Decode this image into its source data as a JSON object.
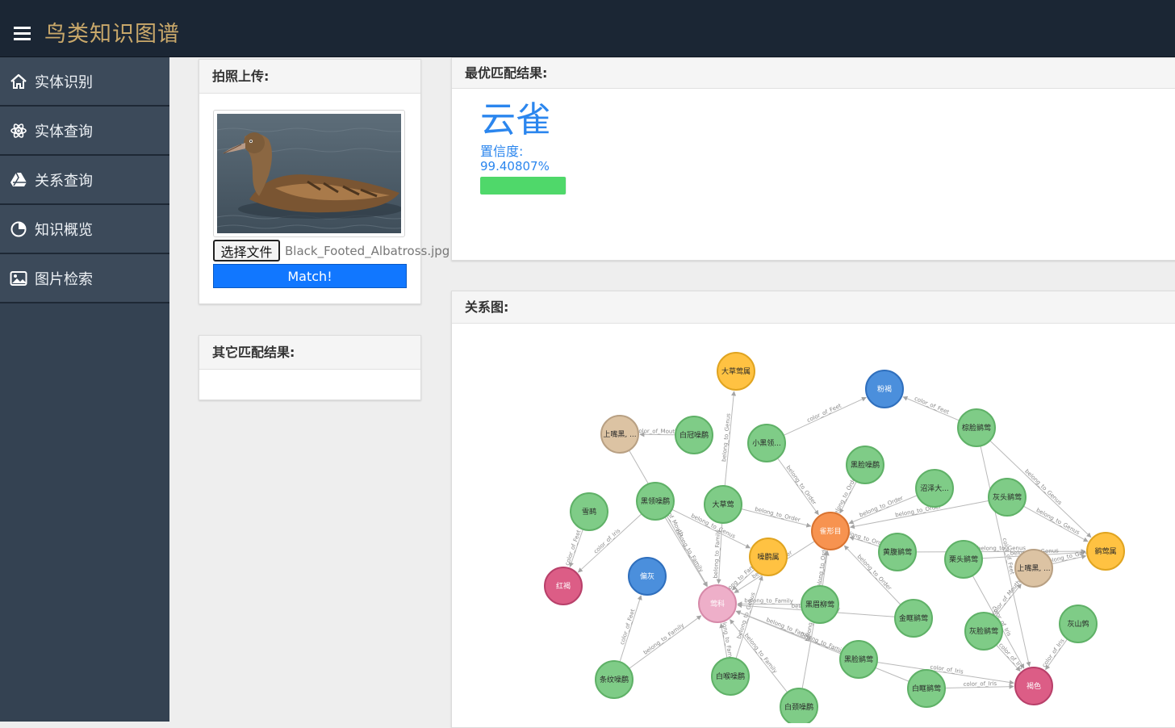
{
  "app": {
    "title": "鸟类知识图谱"
  },
  "sidebar": {
    "items": [
      {
        "label": "实体识别",
        "icon": "home-icon"
      },
      {
        "label": "实体查询",
        "icon": "atom-icon"
      },
      {
        "label": "关系查询",
        "icon": "drive-icon"
      },
      {
        "label": "知识概览",
        "icon": "pie-chart-icon"
      },
      {
        "label": "图片检索",
        "icon": "image-icon"
      }
    ]
  },
  "upload": {
    "title": "拍照上传:",
    "file_button": "选择文件",
    "file_name": "Black_Footed_Albatross.jpg",
    "match_button": "Match!"
  },
  "other_results": {
    "title": "其它匹配结果:"
  },
  "best": {
    "title": "最优匹配结果:",
    "name": "云雀",
    "confidence_label": "置信度:",
    "confidence_value": "99.40807%",
    "confidence_fraction": 0.994
  },
  "graph": {
    "title": "关系图:",
    "colors": {
      "green": "#7fcc87",
      "yellow": "#ffc242",
      "blue": "#4b8fdc",
      "tan": "#dcc3a3",
      "orange": "#f79350",
      "pink": "#eeafc9",
      "red": "#dc5d86"
    },
    "nodes": [
      {
        "id": "n1",
        "label": "大草莺属",
        "color": "yellow"
      },
      {
        "id": "n2",
        "label": "粉褐",
        "color": "blue"
      },
      {
        "id": "n3",
        "label": "上嘴黑, ...",
        "color": "tan"
      },
      {
        "id": "n4",
        "label": "白冠噪鹛",
        "color": "green"
      },
      {
        "id": "n5",
        "label": "小黑领...",
        "color": "green"
      },
      {
        "id": "n6",
        "label": "棕脸鹟莺",
        "color": "green"
      },
      {
        "id": "n7",
        "label": "黑脸噪鹛",
        "color": "green"
      },
      {
        "id": "n8",
        "label": "雪鹀",
        "color": "green"
      },
      {
        "id": "n9",
        "label": "黑领噪鹛",
        "color": "green"
      },
      {
        "id": "n10",
        "label": "大草莺",
        "color": "green"
      },
      {
        "id": "n11",
        "label": "沼泽大...",
        "color": "green"
      },
      {
        "id": "n12",
        "label": "灰头鹟莺",
        "color": "green"
      },
      {
        "id": "n13",
        "label": "雀形目",
        "color": "orange"
      },
      {
        "id": "n14",
        "label": "鹟莺属",
        "color": "yellow"
      },
      {
        "id": "n15",
        "label": "噪鹛属",
        "color": "yellow"
      },
      {
        "id": "n16",
        "label": "黄腹鹟莺",
        "color": "green"
      },
      {
        "id": "n17",
        "label": "栗头鹟莺",
        "color": "green"
      },
      {
        "id": "n18",
        "label": "上嘴黑, ...",
        "color": "tan"
      },
      {
        "id": "n19",
        "label": "红褐",
        "color": "red"
      },
      {
        "id": "n20",
        "label": "偏灰",
        "color": "blue"
      },
      {
        "id": "n21",
        "label": "莺科",
        "color": "pink"
      },
      {
        "id": "n22",
        "label": "黑眉柳莺",
        "color": "green"
      },
      {
        "id": "n23",
        "label": "金眶鹟莺",
        "color": "green"
      },
      {
        "id": "n24",
        "label": "灰脸鹟莺",
        "color": "green"
      },
      {
        "id": "n25",
        "label": "灰山鹑",
        "color": "green"
      },
      {
        "id": "n26",
        "label": "黑脸鹟莺",
        "color": "green"
      },
      {
        "id": "n27",
        "label": "条纹噪鹛",
        "color": "green"
      },
      {
        "id": "n28",
        "label": "白喉噪鹛",
        "color": "green"
      },
      {
        "id": "n29",
        "label": "白眶鹟莺",
        "color": "green"
      },
      {
        "id": "n30",
        "label": "褐色",
        "color": "red"
      },
      {
        "id": "n31",
        "label": "白颈噪鹛",
        "color": "green"
      }
    ],
    "edges": [
      {
        "from": "n10",
        "to": "n1",
        "label": "belong_to_Genus"
      },
      {
        "from": "n6",
        "to": "n2",
        "label": "color_of_Feet"
      },
      {
        "from": "n4",
        "to": "n3",
        "label": "color_of_Mouth"
      },
      {
        "from": "n5",
        "to": "n13",
        "label": "belong_to_Order"
      },
      {
        "from": "n5",
        "to": "n2",
        "label": "color_of_Feet"
      },
      {
        "from": "n6",
        "to": "n14",
        "label": "belong_to_Genus"
      },
      {
        "from": "n6",
        "to": "n30",
        "label": "color_of_Feet"
      },
      {
        "from": "n7",
        "to": "n13",
        "label": "belong_to_Order"
      },
      {
        "from": "n8",
        "to": "n19",
        "label": "color_of_Feet"
      },
      {
        "from": "n9",
        "to": "n15",
        "label": "belong_to_Genus"
      },
      {
        "from": "n9",
        "to": "n21",
        "label": "belong_to_Family"
      },
      {
        "from": "n9",
        "to": "n19",
        "label": "color_of_Iris"
      },
      {
        "from": "n10",
        "to": "n13",
        "label": "belong_to_Order"
      },
      {
        "from": "n10",
        "to": "n21",
        "label": "belong_to_Family"
      },
      {
        "from": "n11",
        "to": "n13",
        "label": "belong_to_Order"
      },
      {
        "from": "n12",
        "to": "n14",
        "label": "belong_to_Genus"
      },
      {
        "from": "n12",
        "to": "n13",
        "label": "belong_to_Order"
      },
      {
        "from": "n15",
        "to": "n21",
        "label": "belong_to_Family"
      },
      {
        "from": "n16",
        "to": "n13",
        "label": "belong_to_Order"
      },
      {
        "from": "n16",
        "to": "n14",
        "label": "belong_to_Genus"
      },
      {
        "from": "n17",
        "to": "n14",
        "label": "belong_to_Genus"
      },
      {
        "from": "n17",
        "to": "n30",
        "label": "color_of_Iris"
      },
      {
        "from": "n18",
        "to": "n14",
        "label": "belong_to_Genus"
      },
      {
        "from": "n22",
        "to": "n21",
        "label": "belong_to_Family"
      },
      {
        "from": "n22",
        "to": "n13",
        "label": "belong_to_Order"
      },
      {
        "from": "n23",
        "to": "n21",
        "label": "belong_to_Family"
      },
      {
        "from": "n23",
        "to": "n13",
        "label": "belong_to_Order"
      },
      {
        "from": "n24",
        "to": "n18",
        "label": "color_of_Mouth"
      },
      {
        "from": "n24",
        "to": "n30",
        "label": "color_of_Iris"
      },
      {
        "from": "n25",
        "to": "n30",
        "label": "color_of_Iris"
      },
      {
        "from": "n26",
        "to": "n21",
        "label": "belong_to_Family"
      },
      {
        "from": "n26",
        "to": "n30",
        "label": "color_of_Iris"
      },
      {
        "from": "n27",
        "to": "n20",
        "label": "color_of_Feet"
      },
      {
        "from": "n27",
        "to": "n21",
        "label": "belong_to_Family"
      },
      {
        "from": "n28",
        "to": "n21",
        "label": "belong_to_Family"
      },
      {
        "from": "n28",
        "to": "n15",
        "label": "belong_to_Genus"
      },
      {
        "from": "n29",
        "to": "n30",
        "label": "color_of_Iris"
      },
      {
        "from": "n29",
        "to": "n21",
        "label": "belong_to_Family"
      },
      {
        "from": "n31",
        "to": "n21",
        "label": "belong_to_Family"
      },
      {
        "from": "n31",
        "to": "n13",
        "label": "belong_to_Order"
      },
      {
        "from": "n13",
        "to": "n21",
        "label": "belong_to_Order"
      },
      {
        "from": "n3",
        "to": "n21",
        "label": "color_of_Mouth"
      }
    ]
  }
}
